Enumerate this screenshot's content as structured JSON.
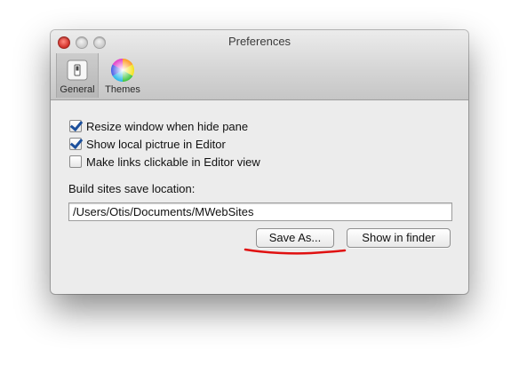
{
  "window": {
    "title": "Preferences"
  },
  "toolbar": {
    "items": [
      {
        "label": "General",
        "icon": "switch-icon",
        "selected": true
      },
      {
        "label": "Themes",
        "icon": "color-wheel-icon",
        "selected": false
      }
    ]
  },
  "general": {
    "checkboxes": [
      {
        "label": "Resize window when hide pane",
        "checked": true
      },
      {
        "label": "Show local pictrue in Editor",
        "checked": true
      },
      {
        "label": "Make links clickable in Editor view",
        "checked": false
      }
    ],
    "build_label": "Build sites save location:",
    "path_value": "/Users/Otis/Documents/MWebSites",
    "save_as_label": "Save As...",
    "show_in_finder_label": "Show in finder"
  },
  "annotation": {
    "color": "#e01010"
  }
}
